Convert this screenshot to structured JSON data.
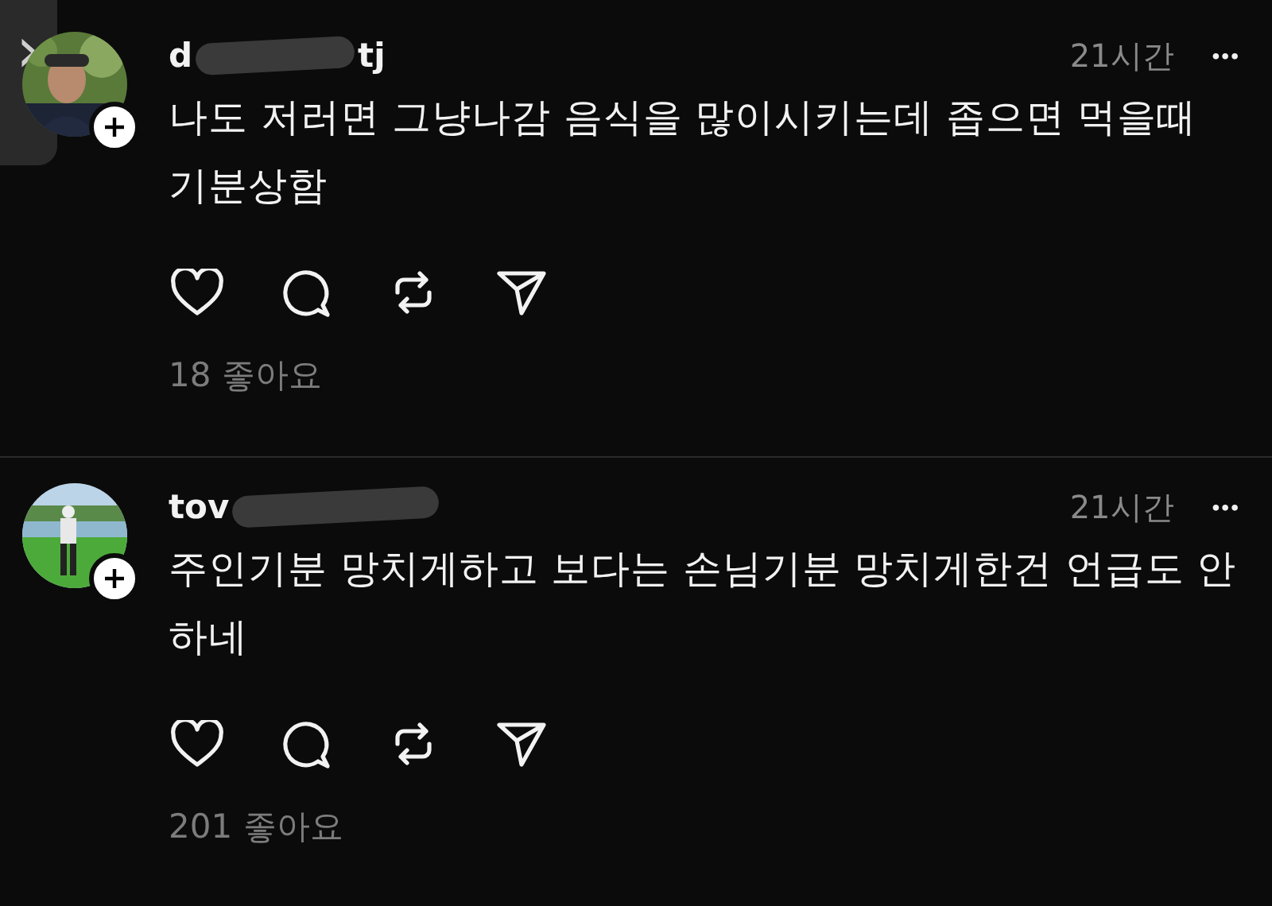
{
  "back_button": {
    "label": "›"
  },
  "posts": [
    {
      "username_start": "d",
      "username_end": "tj",
      "redacted": true,
      "time": "21시간",
      "more": "•••",
      "text": "나도 저러면 그냥나감 음식을 많이시키는데 좁으면 먹을때 기분상함",
      "likes": "18 좋아요"
    },
    {
      "username_start": "tov",
      "redacted": true,
      "time": "21시간",
      "more": "•••",
      "text": "주인기분 망치게하고 보다는 손님기분 망치게한건 언급도 안하네",
      "likes": "201 좋아요"
    }
  ]
}
